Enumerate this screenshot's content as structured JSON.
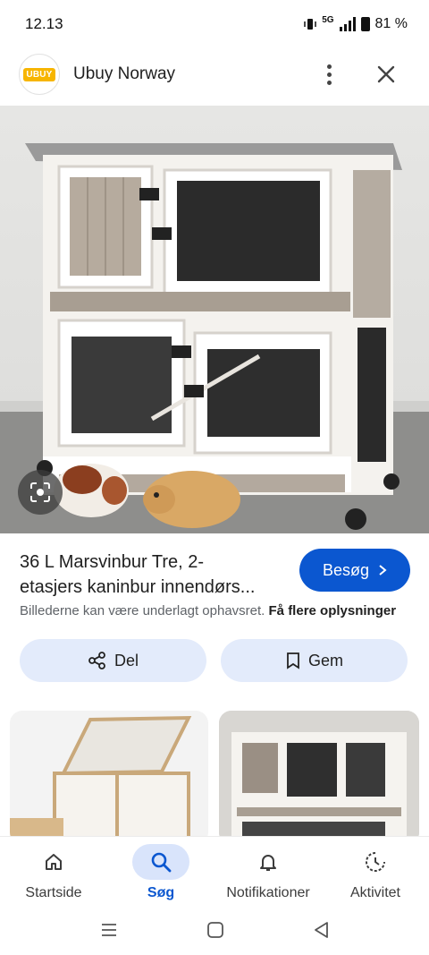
{
  "status": {
    "time": "12.13",
    "network": "5G",
    "battery": "81 %"
  },
  "header": {
    "logo_text": "UBUY",
    "site_name": "Ubuy Norway"
  },
  "product": {
    "title_line1": "36 L Marsvinbur Tre, 2-",
    "title_line2": "etasjers kaninbur innendørs...",
    "visit_label": "Besøg",
    "notice": "Billederne kan være underlagt ophavsret.",
    "notice_link": "Få flere oplysninger",
    "share_label": "Del",
    "save_label": "Gem"
  },
  "nav": {
    "items": [
      {
        "label": "Startside",
        "icon": "home-icon"
      },
      {
        "label": "Søg",
        "icon": "search-icon",
        "active": true
      },
      {
        "label": "Notifikationer",
        "icon": "bell-icon"
      },
      {
        "label": "Aktivitet",
        "icon": "history-icon"
      }
    ]
  },
  "colors": {
    "accent": "#0b57d0",
    "pill_bg": "#e3ebfb",
    "active_nav_bg": "#d9e4fb"
  }
}
